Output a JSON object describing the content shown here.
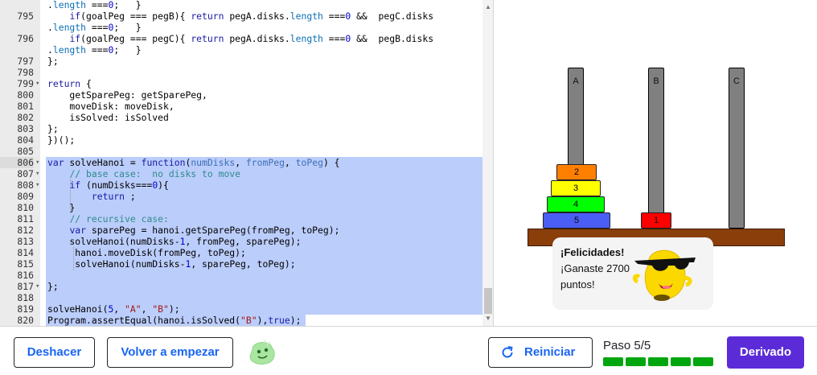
{
  "editor": {
    "lines": [
      {
        "num": "",
        "html": ".<span class=\"prop\">length</span> ===<span class=\"n\">0</span>;   }"
      },
      {
        "num": "795",
        "html": "    <span class=\"k\">if</span>(goalPeg === pegB){ <span class=\"k\">return</span> pegA.disks.<span class=\"prop\">length</span> ===<span class=\"n\">0</span> &amp;&amp;  pegC.disks"
      },
      {
        "num": "",
        "html": ".<span class=\"prop\">length</span> ===<span class=\"n\">0</span>;   }"
      },
      {
        "num": "796",
        "html": "    <span class=\"k\">if</span>(goalPeg === pegC){ <span class=\"k\">return</span> pegA.disks.<span class=\"prop\">length</span> ===<span class=\"n\">0</span> &amp;&amp;  pegB.disks"
      },
      {
        "num": "",
        "html": ".<span class=\"prop\">length</span> ===<span class=\"n\">0</span>;   }"
      },
      {
        "num": "797",
        "html": "};"
      },
      {
        "num": "798",
        "html": ""
      },
      {
        "num": "799",
        "fold": true,
        "html": "<span class=\"k\">return</span> {"
      },
      {
        "num": "800",
        "html": "    getSparePeg: getSparePeg,"
      },
      {
        "num": "801",
        "html": "    moveDisk: moveDisk,"
      },
      {
        "num": "802",
        "html": "    isSolved: isSolved"
      },
      {
        "num": "803",
        "html": "};"
      },
      {
        "num": "804",
        "html": "})();"
      },
      {
        "num": "805",
        "html": ""
      },
      {
        "num": "806",
        "fold": true,
        "active": true,
        "html": "<span class=\"k\">var</span> solveHanoi = <span class=\"k\">function</span>(<span class=\"p\">numDisks</span>, <span class=\"p\">fromPeg</span>, <span class=\"p\">toPeg</span>) {"
      },
      {
        "num": "807",
        "fold": true,
        "html": "    <span class=\"c\">// base case:  no disks to move</span>"
      },
      {
        "num": "808",
        "fold": true,
        "html": "    <span class=\"k\">if</span> (numDisks===<span class=\"n\">0</span>){"
      },
      {
        "num": "809",
        "html": "        <span class=\"k\">return</span> ;"
      },
      {
        "num": "810",
        "html": "    }"
      },
      {
        "num": "811",
        "html": "    <span class=\"c\">// recursive case:</span>"
      },
      {
        "num": "812",
        "html": "    <span class=\"k\">var</span> sparePeg = hanoi.getSparePeg(fromPeg, toPeg);"
      },
      {
        "num": "813",
        "html": "    solveHanoi(numDisks-<span class=\"n\">1</span>, fromPeg, sparePeg);"
      },
      {
        "num": "814",
        "html": "     hanoi.moveDisk(fromPeg, toPeg);"
      },
      {
        "num": "815",
        "html": "     solveHanoi(numDisks-<span class=\"n\">1</span>, sparePeg, toPeg);"
      },
      {
        "num": "816",
        "html": ""
      },
      {
        "num": "817",
        "fold": true,
        "html": "};"
      },
      {
        "num": "818",
        "html": ""
      },
      {
        "num": "819",
        "html": "solveHanoi(<span class=\"n\">5</span>, <span class=\"s\">\"A\"</span>, <span class=\"s\">\"B\"</span>);"
      },
      {
        "num": "820",
        "html": "Program.assertEqual(hanoi.isSolved(<span class=\"s\">\"B\"</span>),<span class=\"k\">true</span>);"
      }
    ]
  },
  "hanoi": {
    "pegs": [
      "A",
      "B",
      "C"
    ],
    "disks_peg_a": [
      "2",
      "3",
      "4",
      "5"
    ],
    "disks_peg_b": [
      "1"
    ],
    "colors": {
      "d1": "#ff0000",
      "d2": "#ff7f00",
      "d3": "#ffff00",
      "d4": "#00ff00",
      "d5": "#4a5ef5"
    }
  },
  "toast": {
    "title": "¡Felicidades!",
    "line1": "¡Ganaste 2700",
    "line2": "puntos!"
  },
  "footer": {
    "undo": "Deshacer",
    "start_over": "Volver a empezar",
    "restart": "Reiniciar",
    "step": "Paso 5/5",
    "progress_complete": 1.0,
    "next": "Derivado"
  }
}
